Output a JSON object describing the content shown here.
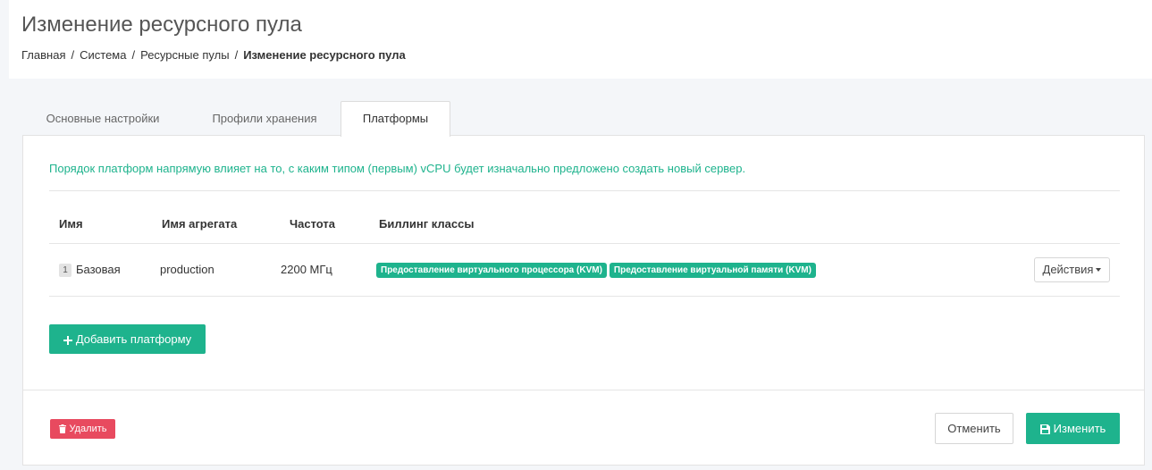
{
  "header": {
    "title": "Изменение ресурсного пула",
    "breadcrumb": [
      "Главная",
      "Система",
      "Ресурсные пулы",
      "Изменение ресурсного пула"
    ]
  },
  "tabs": [
    {
      "label": "Основные настройки",
      "active": false
    },
    {
      "label": "Профили хранения",
      "active": false
    },
    {
      "label": "Платформы",
      "active": true
    }
  ],
  "info_text": "Порядок платформ напрямую влияет на то, с каким типом (первым) vCPU будет изначально предложено создать новый сервер.",
  "table": {
    "columns": [
      "Имя",
      "Имя агрегата",
      "Частота",
      "Биллинг классы"
    ],
    "rows": [
      {
        "order": "1",
        "name": "Базовая",
        "aggregate": "production",
        "frequency": "2200 МГц",
        "billing_classes": [
          "Предоставление виртуального процессора (KVM)",
          "Предоставление виртуальной памяти (KVM)"
        ],
        "actions_label": "Действия"
      }
    ]
  },
  "buttons": {
    "add_platform": "Добавить платформу",
    "delete": "Удалить",
    "cancel": "Отменить",
    "save": "Изменить"
  },
  "colors": {
    "accent": "#1eb38d",
    "danger": "#e84a5f"
  }
}
